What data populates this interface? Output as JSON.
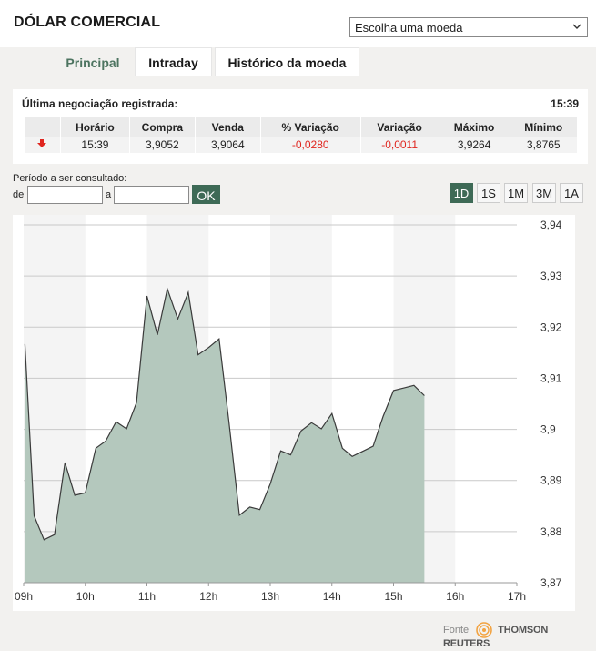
{
  "header": {
    "title": "DÓLAR COMERCIAL",
    "select_value": "Escolha uma moeda"
  },
  "tabs": [
    {
      "label": "Principal",
      "active": true
    },
    {
      "label": "Intraday",
      "active": false
    },
    {
      "label": "Histórico da moeda",
      "active": false
    }
  ],
  "quote": {
    "label": "Última negociação registrada:",
    "time": "15:39",
    "headers": [
      "Horário",
      "Compra",
      "Venda",
      "% Variação",
      "Variação",
      "Máximo",
      "Mínimo"
    ],
    "values": [
      "15:39",
      "3,9052",
      "3,9064",
      "-0,0280",
      "-0,0011",
      "3,9264",
      "3,8765"
    ],
    "trend_icon": "down-arrow-icon",
    "negative_color": "#e0261f"
  },
  "period": {
    "label": "Período a ser consultado:",
    "from_label": "de",
    "to_label": "a",
    "from_value": "",
    "to_value": "",
    "ok_label": "OK"
  },
  "ranges": [
    {
      "label": "1D",
      "active": true
    },
    {
      "label": "1S",
      "active": false
    },
    {
      "label": "1M",
      "active": false
    },
    {
      "label": "3M",
      "active": false
    },
    {
      "label": "1A",
      "active": false
    }
  ],
  "chart_data": {
    "type": "area",
    "x_ticks": [
      "09h",
      "10h",
      "11h",
      "12h",
      "13h",
      "14h",
      "15h",
      "16h",
      "17h"
    ],
    "y_ticks": [
      "3,94",
      "3,93",
      "3,92",
      "3,91",
      "3,9",
      "3,89",
      "3,88",
      "3,87"
    ],
    "xlim": [
      9,
      17
    ],
    "ylim": [
      3.87,
      3.94
    ],
    "fill_color": "#b4c8bd",
    "line_color": "#3a3a3a",
    "grid": true,
    "points": [
      [
        9.02,
        3.9167
      ],
      [
        9.17,
        3.8831
      ],
      [
        9.33,
        3.8784
      ],
      [
        9.5,
        3.8794
      ],
      [
        9.67,
        3.8935
      ],
      [
        9.83,
        3.8871
      ],
      [
        10.0,
        3.8876
      ],
      [
        10.17,
        3.8963
      ],
      [
        10.33,
        3.8977
      ],
      [
        10.5,
        3.9015
      ],
      [
        10.67,
        3.9001
      ],
      [
        10.83,
        3.9052
      ],
      [
        11.0,
        3.9261
      ],
      [
        11.17,
        3.9185
      ],
      [
        11.33,
        3.9275
      ],
      [
        11.5,
        3.9216
      ],
      [
        11.67,
        3.9268
      ],
      [
        11.83,
        3.9146
      ],
      [
        12.0,
        3.916
      ],
      [
        12.17,
        3.9177
      ],
      [
        12.33,
        3.9015
      ],
      [
        12.5,
        3.8832
      ],
      [
        12.67,
        3.8848
      ],
      [
        12.83,
        3.8843
      ],
      [
        13.0,
        3.8893
      ],
      [
        13.17,
        3.8958
      ],
      [
        13.33,
        3.895
      ],
      [
        13.5,
        3.8997
      ],
      [
        13.67,
        3.9013
      ],
      [
        13.83,
        3.9001
      ],
      [
        14.0,
        3.9031
      ],
      [
        14.17,
        3.8963
      ],
      [
        14.33,
        3.8947
      ],
      [
        14.5,
        3.8957
      ],
      [
        14.67,
        3.8967
      ],
      [
        14.83,
        3.9025
      ],
      [
        15.0,
        3.9076
      ],
      [
        15.17,
        3.9081
      ],
      [
        15.33,
        3.9086
      ],
      [
        15.5,
        3.9066
      ]
    ]
  },
  "footer": {
    "source_label": "Fonte",
    "brand": "THOMSON REUTERS"
  }
}
